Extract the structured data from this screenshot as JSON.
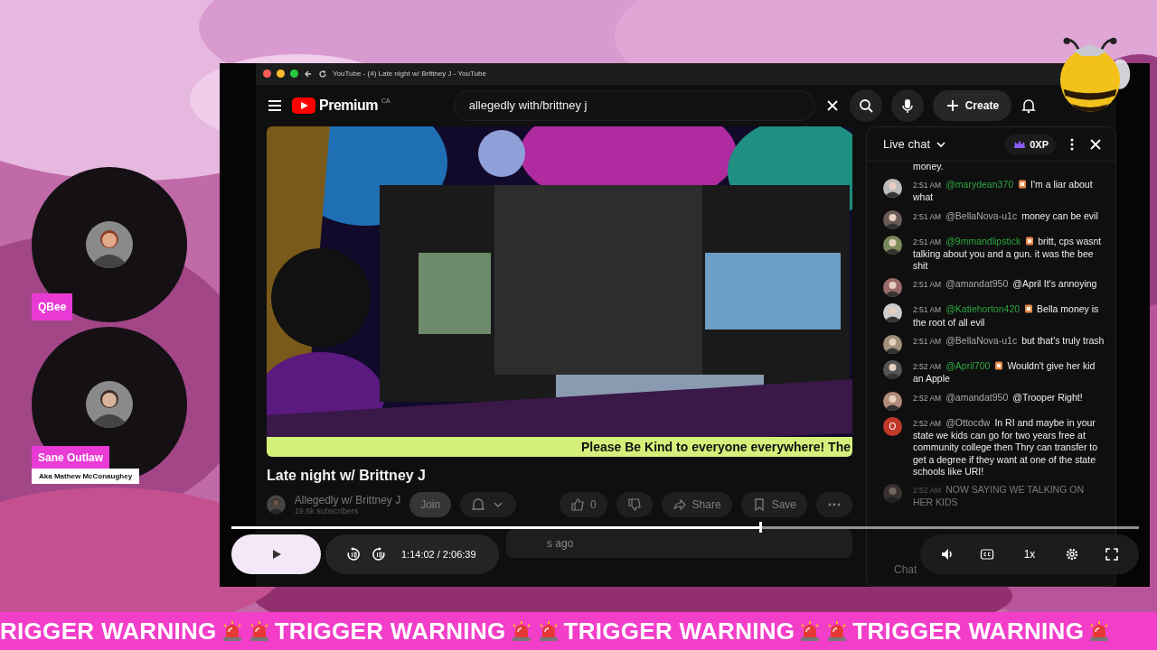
{
  "guests": [
    {
      "name": "QBee"
    },
    {
      "name": "Sane Outlaw",
      "subtitle": "Aka Mathew McConaughey"
    }
  ],
  "browser": {
    "tab_title": "YouTube - (4) Late night w/ Brittney J - YouTube"
  },
  "header": {
    "logo": "Premium",
    "region": "CA",
    "search": {
      "value": "allegedly with/brittney j"
    },
    "create": "Create"
  },
  "video": {
    "ticker": "Please Be Kind to everyone everywhere! The",
    "title": "Late night w/ Brittney J",
    "channel": "Allegedly w/ Brittney J",
    "subscribers": "19.6k subscribers",
    "join": "Join",
    "likes": "0",
    "share": "Share",
    "save": "Save",
    "description": "s ago"
  },
  "chat": {
    "title": "Live chat",
    "points": "0XP",
    "placeholder": "Chat",
    "messages": [
      {
        "kind": "fragment",
        "text": "money."
      },
      {
        "kind": "message",
        "time": "2:51 AM",
        "author": "@marydean370",
        "member": true,
        "text": "I'm a liar about what"
      },
      {
        "kind": "message",
        "time": "2:51 AM",
        "author": "@BellaNova-u1c",
        "member": false,
        "text": "money can be evil"
      },
      {
        "kind": "message",
        "time": "2:51 AM",
        "author": "@9mmandlipstick",
        "member": true,
        "text": "britt, cps wasnt talking about you and a gun. it was the bee shit"
      },
      {
        "kind": "message",
        "time": "2:51 AM",
        "author": "@amandat950",
        "member": false,
        "text": "@April It's annoying"
      },
      {
        "kind": "message",
        "time": "2:51 AM",
        "author": "@Katiehorton420",
        "member": true,
        "text": "Bella money is the root of all evil"
      },
      {
        "kind": "message",
        "time": "2:51 AM",
        "author": "@BellaNova-u1c",
        "member": false,
        "text": "but that's truly trash"
      },
      {
        "kind": "message",
        "time": "2:52 AM",
        "author": "@April700",
        "member": true,
        "text": "Wouldn't give her kid an Apple"
      },
      {
        "kind": "message",
        "time": "2:52 AM",
        "author": "@amandat950",
        "member": false,
        "text": "@Trooper Right!"
      },
      {
        "kind": "message",
        "time": "2:52 AM",
        "author": "@Ottocdw",
        "member": false,
        "initial": "O",
        "color": "#c0392b",
        "text": "In RI and maybe in your state we kids can go for two years free at community college then Thry can transfer to get a degree if they want at one of the state schools like URI!"
      },
      {
        "kind": "message",
        "time": "2:52 AM",
        "member": false,
        "text": "NOW SAYING WE TALKING ON HER KIDS"
      }
    ]
  },
  "player": {
    "playing": false,
    "progress": {
      "level": 0.583
    },
    "time": "1:14:02 / 2:06:39",
    "speed": "1x"
  },
  "banner": [
    {
      "kind": "text",
      "text": "RIGGER WARNING"
    },
    {
      "kind": "siren"
    },
    {
      "kind": "siren"
    },
    {
      "kind": "text",
      "text": "TRIGGER WARNING"
    },
    {
      "kind": "siren"
    },
    {
      "kind": "siren"
    },
    {
      "kind": "text",
      "text": "TRIGGER WARNING"
    },
    {
      "kind": "siren"
    },
    {
      "kind": "siren"
    },
    {
      "kind": "text",
      "text": "TRIGGER WARNING"
    },
    {
      "kind": "siren"
    }
  ]
}
